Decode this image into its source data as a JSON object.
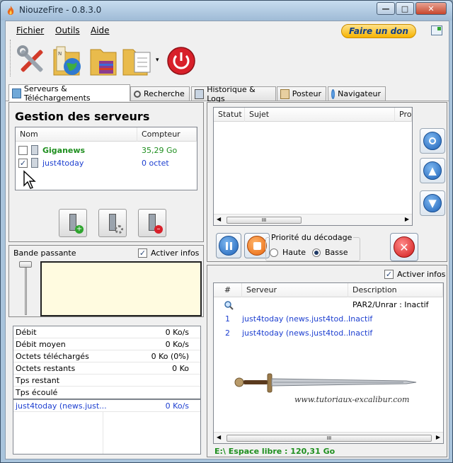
{
  "window": {
    "title": "NiouzeFire - 0.8.3.0",
    "minimize": "—",
    "maximize": "□",
    "close": "✕"
  },
  "menu": {
    "items": [
      "Fichier",
      "Outils",
      "Aide"
    ],
    "donate": "Faire un don"
  },
  "toolbar": {
    "buttons": [
      "settings-icon",
      "nzb-globe-icon",
      "archive-folder-icon",
      "document-folder-icon",
      "power-icon"
    ],
    "dropdown": "▾"
  },
  "tabs": [
    {
      "label": "Serveurs & Téléchargements",
      "active": true
    },
    {
      "label": "Recherche"
    },
    {
      "label": "Historique & Logs"
    },
    {
      "label": "Posteur"
    },
    {
      "label": "Navigateur"
    }
  ],
  "servers": {
    "title": "Gestion des serveurs",
    "columns": [
      "Nom",
      "Compteur"
    ],
    "rows": [
      {
        "name": "Giganews",
        "counter": "35,29 Go",
        "checked": false,
        "color": "#1f8f1f"
      },
      {
        "name": "just4today",
        "counter": "0 octet",
        "checked": true,
        "color": "#1d3fd0"
      }
    ]
  },
  "bandwidth": {
    "title": "Bande passante",
    "activer": "Activer infos",
    "activer_checked": true
  },
  "stats": [
    {
      "label": "Débit",
      "value": "0 Ko/s"
    },
    {
      "label": "Débit moyen",
      "value": "0 Ko/s"
    },
    {
      "label": "Octets téléchargés",
      "value": "0 Ko (0%)"
    },
    {
      "label": "Octets restants",
      "value": "0 Ko"
    },
    {
      "label": "Tps restant",
      "value": ""
    },
    {
      "label": "Tps écoulé",
      "value": ""
    }
  ],
  "conn_list": [
    {
      "name": "just4today (news.just...",
      "value": "0 Ko/s"
    }
  ],
  "downloads": {
    "columns": [
      "Statut",
      "Sujet",
      "Pro"
    ],
    "scroll_mark": "III"
  },
  "decode": {
    "title": "Priorité du décodage",
    "options": [
      "Haute",
      "Basse"
    ],
    "selected": "Basse"
  },
  "connections": {
    "activer": "Activer infos",
    "activer_checked": true,
    "columns": [
      "#",
      "Serveur",
      "Description"
    ],
    "rows": [
      {
        "num": "",
        "server": "",
        "desc": "PAR2/Unrar : Inactif",
        "icon": "search-icon"
      },
      {
        "num": "1",
        "server": "just4today (news.just4tod...",
        "desc": "Inactif"
      },
      {
        "num": "2",
        "server": "just4today (news.just4tod...",
        "desc": "Inactif"
      }
    ],
    "watermark": "www.tutoriaux-excalibur.com",
    "scroll_mark": "III"
  },
  "status": {
    "free_space": "E:\\ Espace libre : 120,31 Go"
  },
  "colors": {
    "accent": "#1d62b8",
    "green": "#1f8f1f",
    "link_blue": "#1d3fd0"
  }
}
